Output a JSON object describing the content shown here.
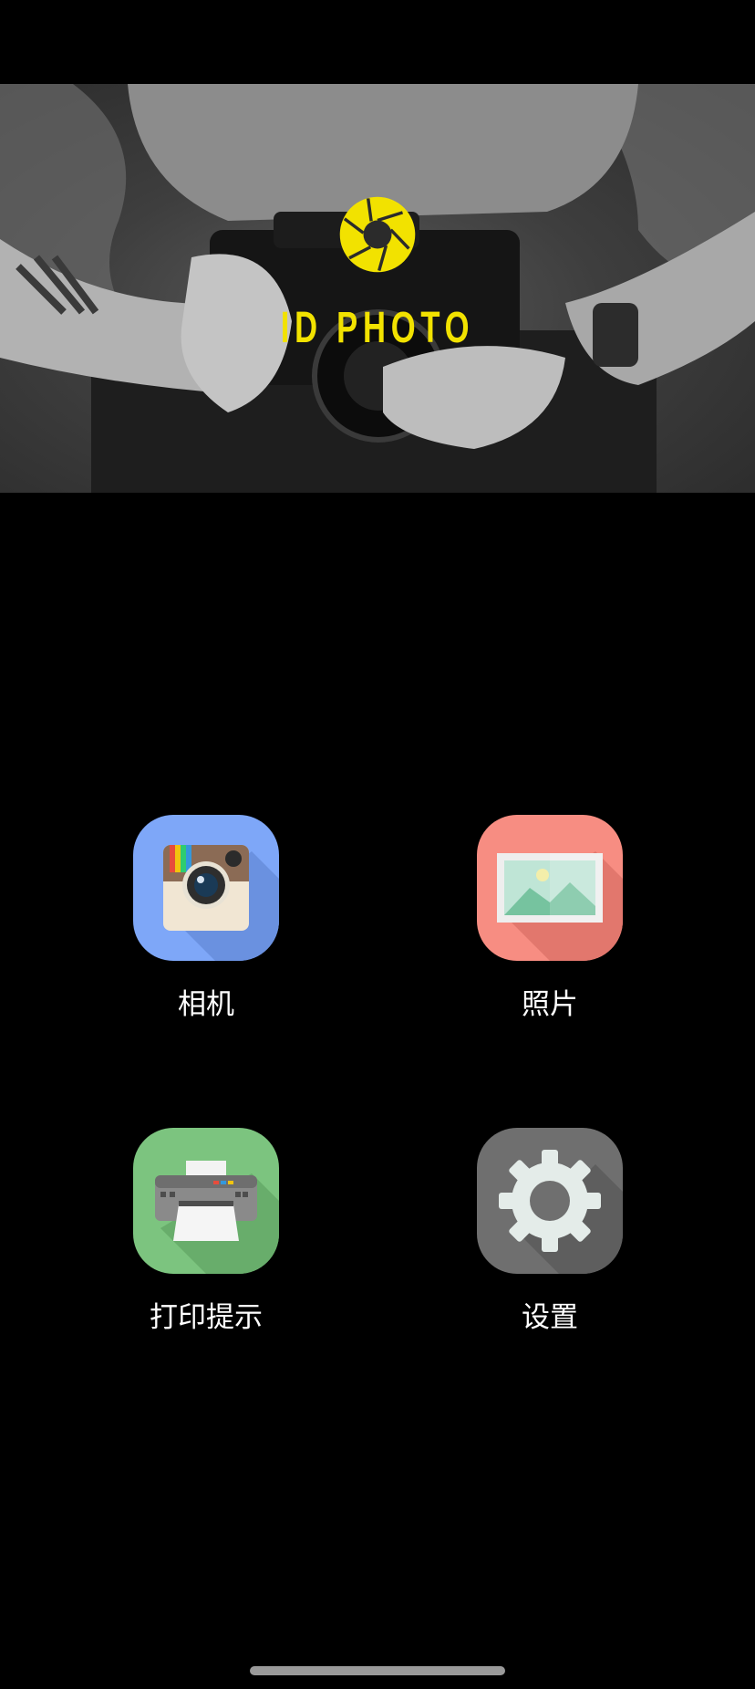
{
  "banner": {
    "logo_text": "ID PHOTO",
    "logo_color": "#f2e200",
    "logo_icon": "aperture-icon"
  },
  "menu": {
    "items": [
      {
        "id": "camera",
        "label": "相机",
        "icon": "camera-icon",
        "color": "#7ea7f8"
      },
      {
        "id": "photos",
        "label": "照片",
        "icon": "picture-icon",
        "color": "#f78d82"
      },
      {
        "id": "print",
        "label": "打印提示",
        "icon": "printer-icon",
        "color": "#7cc47f"
      },
      {
        "id": "settings",
        "label": "设置",
        "icon": "gear-icon",
        "color": "#6f6f6f"
      }
    ]
  }
}
